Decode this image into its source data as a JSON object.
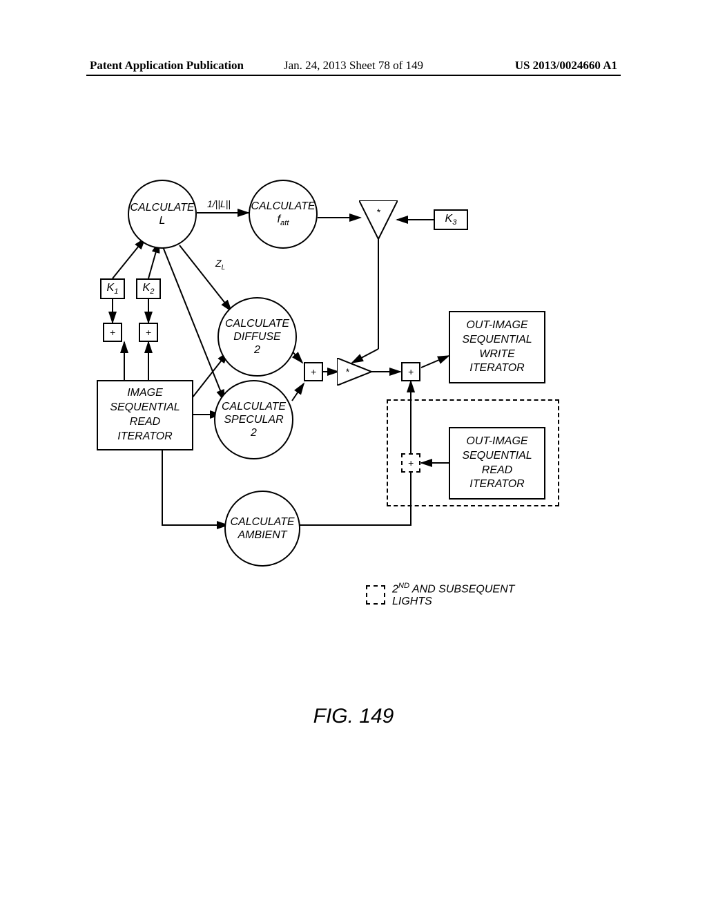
{
  "header": {
    "left": "Patent Application Publication",
    "center": "Jan. 24, 2013  Sheet 78 of 149",
    "right": "US 2013/0024660 A1"
  },
  "nodes": {
    "calcL": "CALCULATE\nL",
    "calcFatt": "CALCULATE\nf",
    "fatt_sub": "att",
    "calcDiffuse2": "CALCULATE\nDIFFUSE\n2",
    "calcSpecular2": "CALCULATE\nSPECULAR\n2",
    "calcAmbient": "CALCULATE\nAMBIENT",
    "k1": "K",
    "k1_sub": "1",
    "k2": "K",
    "k2_sub": "2",
    "k3": "K",
    "k3_sub": "3",
    "imageSeqRead": "IMAGE\nSEQUENTIAL\nREAD\nITERATOR",
    "outImageSeqWrite": "OUT-IMAGE\nSEQUENTIAL\nWRITE\nITERATOR",
    "outImageSeqRead": "OUT-IMAGE\nSEQUENTIAL\nREAD\nITERATOR"
  },
  "operators": {
    "plus1": "+",
    "plus2": "+",
    "plus3": "+",
    "plus4": "+",
    "plus5": "+",
    "mul1": "*",
    "mul2": "*"
  },
  "edgeLabels": {
    "invL": "1/||L||",
    "zL": "Z",
    "zL_sub": "L"
  },
  "legend": {
    "text": "2",
    "text_sup": "ND",
    "text2": " AND SUBSEQUENT\nLIGHTS"
  },
  "figureCaption": "FIG. 149"
}
